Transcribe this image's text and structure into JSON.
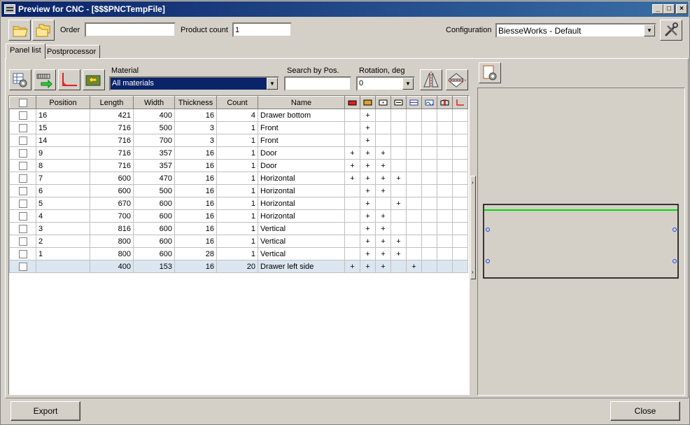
{
  "window": {
    "title": "Preview for CNC - [$$$PNCTempFile]"
  },
  "toolbar": {
    "order_label": "Order",
    "order_value": "",
    "product_count_label": "Product count",
    "product_count_value": "1",
    "configuration_label": "Configuration",
    "configuration_value": "BiesseWorks - Default"
  },
  "tabs": [
    "Panel list",
    "Postprocessor"
  ],
  "filters": {
    "material_label": "Material",
    "material_value": "All materials",
    "search_label": "Search by Pos.",
    "search_value": "",
    "rotation_label": "Rotation, deg",
    "rotation_value": "0"
  },
  "table": {
    "columns": [
      "Position",
      "Length",
      "Width",
      "Thickness",
      "Count",
      "Name"
    ],
    "op_columns": [
      "op-1-icon",
      "op-2-icon",
      "op-3-icon",
      "op-4-icon",
      "op-5-icon",
      "op-6-icon",
      "op-7-icon",
      "op-8-icon"
    ],
    "rows": [
      {
        "position": "16",
        "length": "421",
        "width": "400",
        "thickness": "16",
        "count": "4",
        "name": "Drawer bottom",
        "ops": [
          "",
          "+",
          "",
          "",
          "",
          "",
          "",
          ""
        ]
      },
      {
        "position": "15",
        "length": "716",
        "width": "500",
        "thickness": "3",
        "count": "1",
        "name": "Front",
        "ops": [
          "",
          "+",
          "",
          "",
          "",
          "",
          "",
          ""
        ]
      },
      {
        "position": "14",
        "length": "716",
        "width": "700",
        "thickness": "3",
        "count": "1",
        "name": "Front",
        "ops": [
          "",
          "+",
          "",
          "",
          "",
          "",
          "",
          ""
        ]
      },
      {
        "position": "9",
        "length": "716",
        "width": "357",
        "thickness": "16",
        "count": "1",
        "name": "Door",
        "ops": [
          "+",
          "+",
          "+",
          "",
          "",
          "",
          "",
          ""
        ]
      },
      {
        "position": "8",
        "length": "716",
        "width": "357",
        "thickness": "16",
        "count": "1",
        "name": "Door",
        "ops": [
          "+",
          "+",
          "+",
          "",
          "",
          "",
          "",
          ""
        ]
      },
      {
        "position": "7",
        "length": "600",
        "width": "470",
        "thickness": "16",
        "count": "1",
        "name": "Horizontal",
        "ops": [
          "+",
          "+",
          "+",
          "+",
          "",
          "",
          "",
          ""
        ]
      },
      {
        "position": "6",
        "length": "600",
        "width": "500",
        "thickness": "16",
        "count": "1",
        "name": "Horizontal",
        "ops": [
          "",
          "+",
          "+",
          "",
          "",
          "",
          "",
          ""
        ]
      },
      {
        "position": "5",
        "length": "670",
        "width": "600",
        "thickness": "16",
        "count": "1",
        "name": "Horizontal",
        "ops": [
          "",
          "+",
          "",
          "+",
          "",
          "",
          "",
          ""
        ]
      },
      {
        "position": "4",
        "length": "700",
        "width": "600",
        "thickness": "16",
        "count": "1",
        "name": "Horizontal",
        "ops": [
          "",
          "+",
          "+",
          "",
          "",
          "",
          "",
          ""
        ]
      },
      {
        "position": "3",
        "length": "816",
        "width": "600",
        "thickness": "16",
        "count": "1",
        "name": "Vertical",
        "ops": [
          "",
          "+",
          "+",
          "",
          "",
          "",
          "",
          ""
        ]
      },
      {
        "position": "2",
        "length": "800",
        "width": "600",
        "thickness": "16",
        "count": "1",
        "name": "Vertical",
        "ops": [
          "",
          "+",
          "+",
          "+",
          "",
          "",
          "",
          ""
        ]
      },
      {
        "position": "1",
        "length": "800",
        "width": "600",
        "thickness": "28",
        "count": "1",
        "name": "Vertical",
        "ops": [
          "",
          "+",
          "+",
          "+",
          "",
          "",
          "",
          ""
        ]
      },
      {
        "position": "",
        "length": "400",
        "width": "153",
        "thickness": "16",
        "count": "20",
        "name": "Drawer left side",
        "ops": [
          "+",
          "+",
          "+",
          "",
          "+",
          "",
          "",
          ""
        ],
        "selected": true
      }
    ]
  },
  "buttons": {
    "export": "Export",
    "close": "Close"
  },
  "colors": {
    "title_start": "#0a246a",
    "title_end": "#3a6ea5",
    "preview_line": "#00dd00",
    "selected_row": "#dbe6f0"
  }
}
